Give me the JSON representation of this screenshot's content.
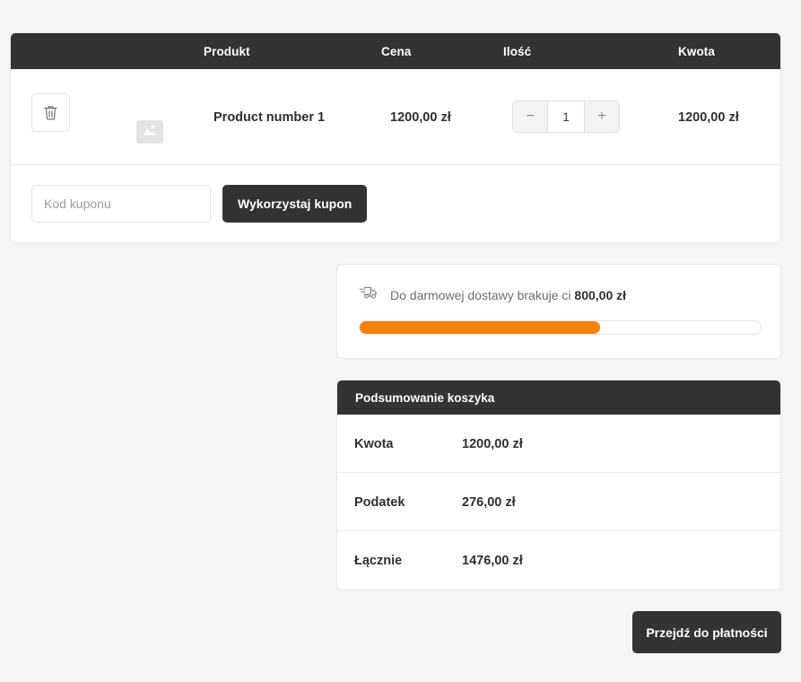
{
  "colors": {
    "header_dark": "#333333",
    "accent_orange": "#f98100",
    "page_bg": "#f5f5f5",
    "card_bg": "#ffffff"
  },
  "cart": {
    "columns": {
      "product": "Produkt",
      "price": "Cena",
      "quantity": "Ilość",
      "amount": "Kwota"
    },
    "items": [
      {
        "name": "Product number 1",
        "price": "1200,00 zł",
        "quantity": "1",
        "amount": "1200,00 zł",
        "remove_icon": "trash-icon",
        "thumbnail_icon": "image-placeholder-icon",
        "decrease_label": "−",
        "increase_label": "+"
      }
    ],
    "coupon": {
      "placeholder": "Kod kuponu",
      "value": "",
      "button_label": "Wykorzystaj kupon"
    }
  },
  "shipping": {
    "icon": "delivery-truck-icon",
    "message_prefix": "Do darmowej dostawy brakuje ci ",
    "message_amount": "800,00 zł",
    "progress_percent": 60
  },
  "summary": {
    "title": "Podsumowanie koszyka",
    "rows": [
      {
        "label": "Kwota",
        "value": "1200,00 zł"
      },
      {
        "label": "Podatek",
        "value": "276,00 zł"
      },
      {
        "label": "Łącznie",
        "value": "1476,00 zł"
      }
    ]
  },
  "checkout": {
    "label": "Przejdź do płatności"
  }
}
